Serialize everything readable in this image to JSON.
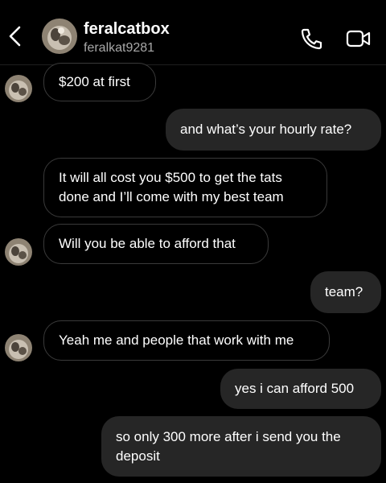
{
  "contact": {
    "name": "feralcatbox",
    "username": "feralkat9281"
  },
  "messages": [
    {
      "direction": "incoming",
      "text": "$200 at first"
    },
    {
      "direction": "outgoing",
      "text": "and what’s your hourly rate?"
    },
    {
      "direction": "incoming",
      "text": "It will all cost you $500 to get the tats done and I’ll come with my best team"
    },
    {
      "direction": "incoming",
      "text": "Will you be able to afford that"
    },
    {
      "direction": "outgoing",
      "text": "team?"
    },
    {
      "direction": "incoming",
      "text": "Yeah me and people that work with me"
    },
    {
      "direction": "outgoing",
      "text": "yes i can afford 500"
    },
    {
      "direction": "outgoing",
      "text": "so only 300 more after i send you the deposit"
    }
  ]
}
